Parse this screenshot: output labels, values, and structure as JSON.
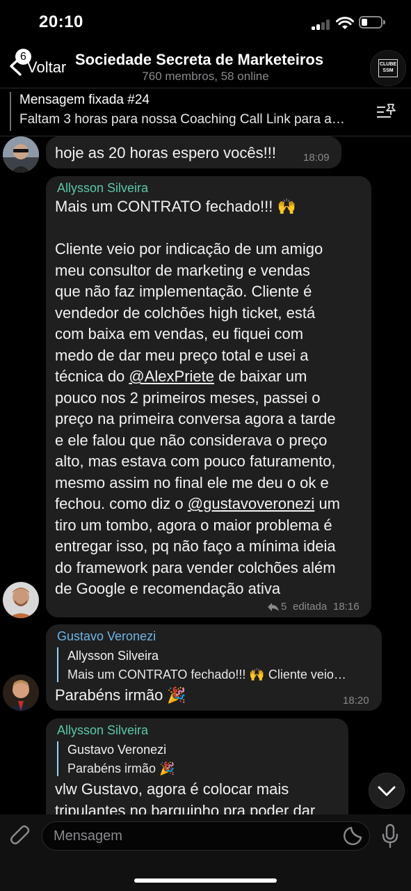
{
  "status_bar": {
    "time": "20:10",
    "battery_level": 0.3
  },
  "header": {
    "back_badge": "6",
    "back_label": "Voltar",
    "title": "Sociedade Secreta de Marketeiros",
    "subtitle": "760 membros, 58 online",
    "avatar_text": "CLUBE SSM"
  },
  "pinned": {
    "title": "Mensagem fixada #24",
    "text": "Faltam 3 horas para nossa Coaching Call Link para a…"
  },
  "messages": [
    {
      "text": "hoje as 20 horas espero vocês!!!",
      "time": "18:09"
    },
    {
      "sender": "Allysson Silveira",
      "text_a": "Mais um CONTRATO fechado!!! 🙌\n\nCliente veio por indicação de um amigo\nmeu consultor de marketing e vendas\nque não faz implementação. Cliente é\nvendedor de colchões high ticket, está\ncom baixa em vendas, eu fiquei com\nmedo de dar meu preço total e usei a\ntécnica do ",
      "mention_1": "@AlexPriete",
      "text_b": " de baixar um\npouco nos 2 primeiros meses, passei o\npreço na primeira conversa agora a tarde\ne ele falou que não considerava o preço\nalto, mas estava com pouco faturamento,\nmesmo assim no final ele me deu o ok e\nfechou. como diz o ",
      "mention_2": "@gustavoveronezi",
      "text_c": " um\ntiro um tombo, agora o maior problema é\nentregar isso, pq não faço a mínima ideia\ndo framework para vender colchões além\nde Google e recomendação ativa",
      "replies": "5",
      "edited_label": "editada",
      "time": "18:16"
    },
    {
      "sender": "Gustavo Veronezi",
      "quote_name": "Allysson Silveira",
      "quote_text": "Mais um CONTRATO fechado!!! 🙌 Cliente veio…",
      "text": "Parabéns irmão 🎉",
      "time": "18:20"
    },
    {
      "sender": "Allysson Silveira",
      "quote_name": "Gustavo Veronezi",
      "quote_text": "Parabéns irmão 🎉",
      "text": "vlw Gustavo, agora é colocar mais\ntripulantes no barquinho pra poder dar"
    }
  ],
  "input": {
    "placeholder": "Mensagem"
  },
  "icons": {
    "back": "chevron-left-icon",
    "pin_list": "pin-list-icon",
    "reply": "reply-arrow-icon",
    "scroll_down": "chevron-down-icon",
    "attach": "paperclip-icon",
    "sticker": "sticker-icon",
    "mic": "microphone-icon"
  },
  "colors": {
    "background": "#000000",
    "bubble": "#1f1f1f",
    "sender_allysson": "#5ac8a8",
    "sender_gustavo": "#6fb6e6",
    "secondary_text": "#8a8a8e"
  }
}
